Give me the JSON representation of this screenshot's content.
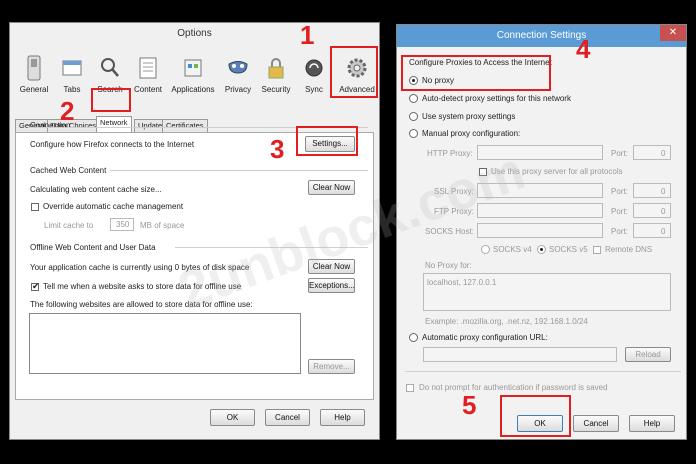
{
  "options": {
    "title": "Options",
    "toolbar": [
      "General",
      "Tabs",
      "Search",
      "Content",
      "Applications",
      "Privacy",
      "Security",
      "Sync",
      "Advanced"
    ],
    "tabs": [
      "General",
      "Data Choices",
      "Network",
      "Update",
      "Certificates"
    ],
    "connection": {
      "title": "Connection",
      "desc": "Configure how Firefox connects to the Internet",
      "settings_btn": "Settings..."
    },
    "cache": {
      "title": "Cached Web Content",
      "usage": "Calculating web content cache size...",
      "clear_btn": "Clear Now",
      "override_label": "Override automatic cache management",
      "limit_label": "Limit cache to",
      "limit_value": "350",
      "limit_unit": "MB of space"
    },
    "offline": {
      "title": "Offline Web Content and User Data",
      "usage": "Your application cache is currently using 0 bytes of disk space",
      "clear_btn": "Clear Now",
      "tell_label": "Tell me when a website asks to store data for offline use",
      "exceptions_btn": "Exceptions...",
      "allowed_label": "The following websites are allowed to store data for offline use:",
      "remove_btn": "Remove..."
    },
    "buttons": {
      "ok": "OK",
      "cancel": "Cancel",
      "help": "Help"
    }
  },
  "conn": {
    "title": "Connection Settings",
    "section": "Configure Proxies to Access the Internet",
    "no_proxy": "No proxy",
    "auto_detect": "Auto-detect proxy settings for this network",
    "system": "Use system proxy settings",
    "manual": "Manual proxy configuration:",
    "http_label": "HTTP Proxy:",
    "port_label": "Port:",
    "port_value": "0",
    "same_proxy": "Use this proxy server for all protocols",
    "ssl_label": "SSL Proxy:",
    "ftp_label": "FTP Proxy:",
    "socks_label": "SOCKS Host:",
    "socks4": "SOCKS v4",
    "socks5": "SOCKS v5",
    "remote_dns": "Remote DNS",
    "no_proxy_for": "No Proxy for:",
    "no_proxy_value": "localhost, 127.0.0.1",
    "example": "Example: .mozilla.org, .net.nz, 192.168.1.0/24",
    "auto_config": "Automatic proxy configuration URL:",
    "reload_btn": "Reload",
    "no_prompt": "Do not prompt for authentication if password is saved",
    "buttons": {
      "ok": "OK",
      "cancel": "Cancel",
      "help": "Help"
    }
  },
  "annotations": {
    "step1": "1",
    "step2": "2",
    "step3": "3",
    "step4": "4",
    "step5": "5",
    "watermark": "2unblock.com",
    "red": "#e02020"
  }
}
